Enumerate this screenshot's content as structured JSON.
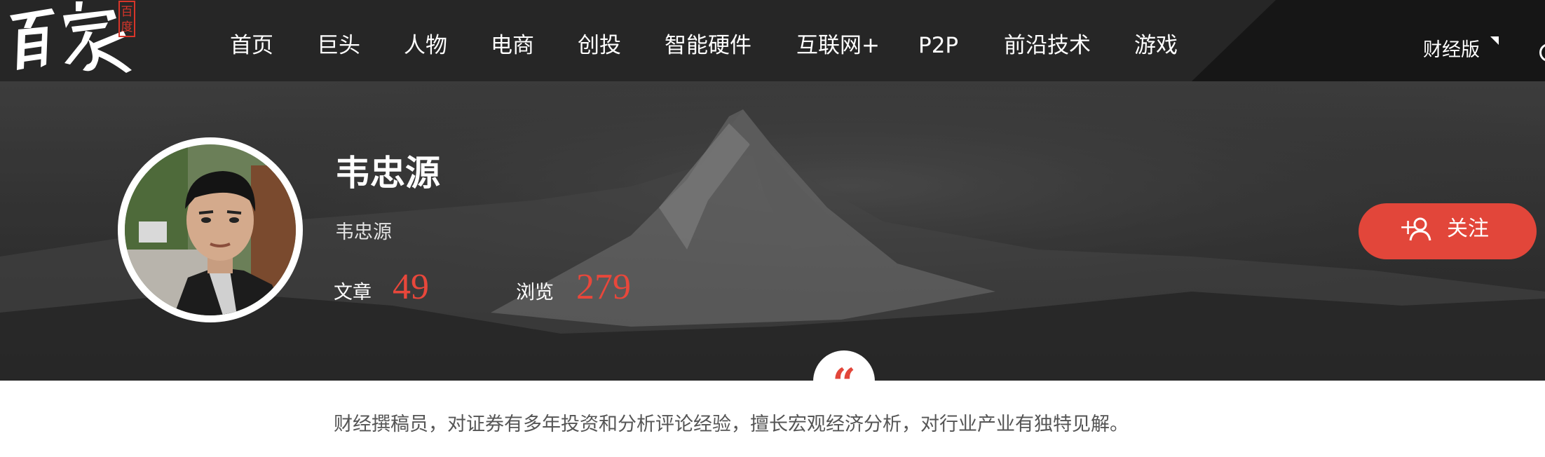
{
  "logo": {
    "text": "百家",
    "seal_text": "百度"
  },
  "nav": {
    "items": [
      {
        "label": "首页"
      },
      {
        "label": "巨头"
      },
      {
        "label": "人物"
      },
      {
        "label": "电商"
      },
      {
        "label": "创投"
      },
      {
        "label": "智能硬件"
      },
      {
        "label": "互联网+"
      },
      {
        "label": "P2P"
      },
      {
        "label": "前沿技术"
      },
      {
        "label": "游戏"
      }
    ],
    "edition_label": "财经版",
    "edition_caret_icon": "caret-down-icon",
    "user_icon": "user-icon"
  },
  "author": {
    "name": "韦忠源",
    "subtitle": "韦忠源",
    "avatar_icon": "avatar-photo",
    "stats": {
      "articles_label": "文章",
      "articles_value": "49",
      "views_label": "浏览",
      "views_value": "279"
    }
  },
  "follow": {
    "plus": "+",
    "icon": "user-add-icon",
    "label": "关注"
  },
  "bio": {
    "quote_icon": "quote-icon",
    "quote_mark": "“",
    "text": "财经撰稿员，对证券有多年投资和分析评论经验，擅长宏观经济分析，对行业产业有独特见解。"
  },
  "colors": {
    "nav_bg": "#262626",
    "accent_red": "#e2463a",
    "stat_red": "#e8473b",
    "bio_text": "#555555"
  }
}
